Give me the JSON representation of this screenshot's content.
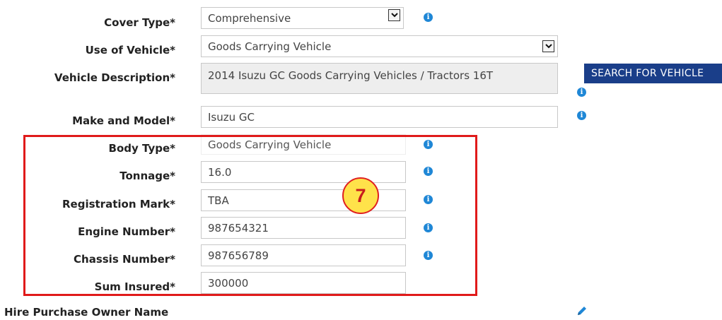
{
  "fields": {
    "cover_type": {
      "label": "Cover Type*",
      "value": "Comprehensive"
    },
    "use_of_vehicle": {
      "label": "Use of Vehicle*",
      "value": "Goods Carrying Vehicle"
    },
    "vehicle_description": {
      "label": "Vehicle Description*",
      "value": "2014 Isuzu GC Goods Carrying Vehicles / Tractors 16T"
    },
    "make_and_model": {
      "label": "Make and Model*",
      "value": "Isuzu GC"
    },
    "body_type": {
      "label": "Body Type*",
      "value": "Goods Carrying Vehicle"
    },
    "tonnage": {
      "label": "Tonnage*",
      "value": "16.0"
    },
    "registration_mark": {
      "label": "Registration Mark*",
      "value": "TBA"
    },
    "engine_number": {
      "label": "Engine Number*",
      "value": "987654321"
    },
    "chassis_number": {
      "label": "Chassis Number*",
      "value": "987656789"
    },
    "sum_insured": {
      "label": "Sum Insured*",
      "value": "300000"
    }
  },
  "search_button": "SEARCH FOR VEHICLE",
  "hire_purchase_label": "Hire Purchase Owner Name",
  "annotation_badge": "7",
  "icons": {
    "info": "info-icon",
    "edit": "pencil-icon",
    "dropdown": "chevron-down-icon"
  },
  "colors": {
    "info_icon": "#1f87d6",
    "button_bg": "#1a3e89",
    "highlight_border": "#e01a1a",
    "badge_fill": "#ffe24a"
  }
}
